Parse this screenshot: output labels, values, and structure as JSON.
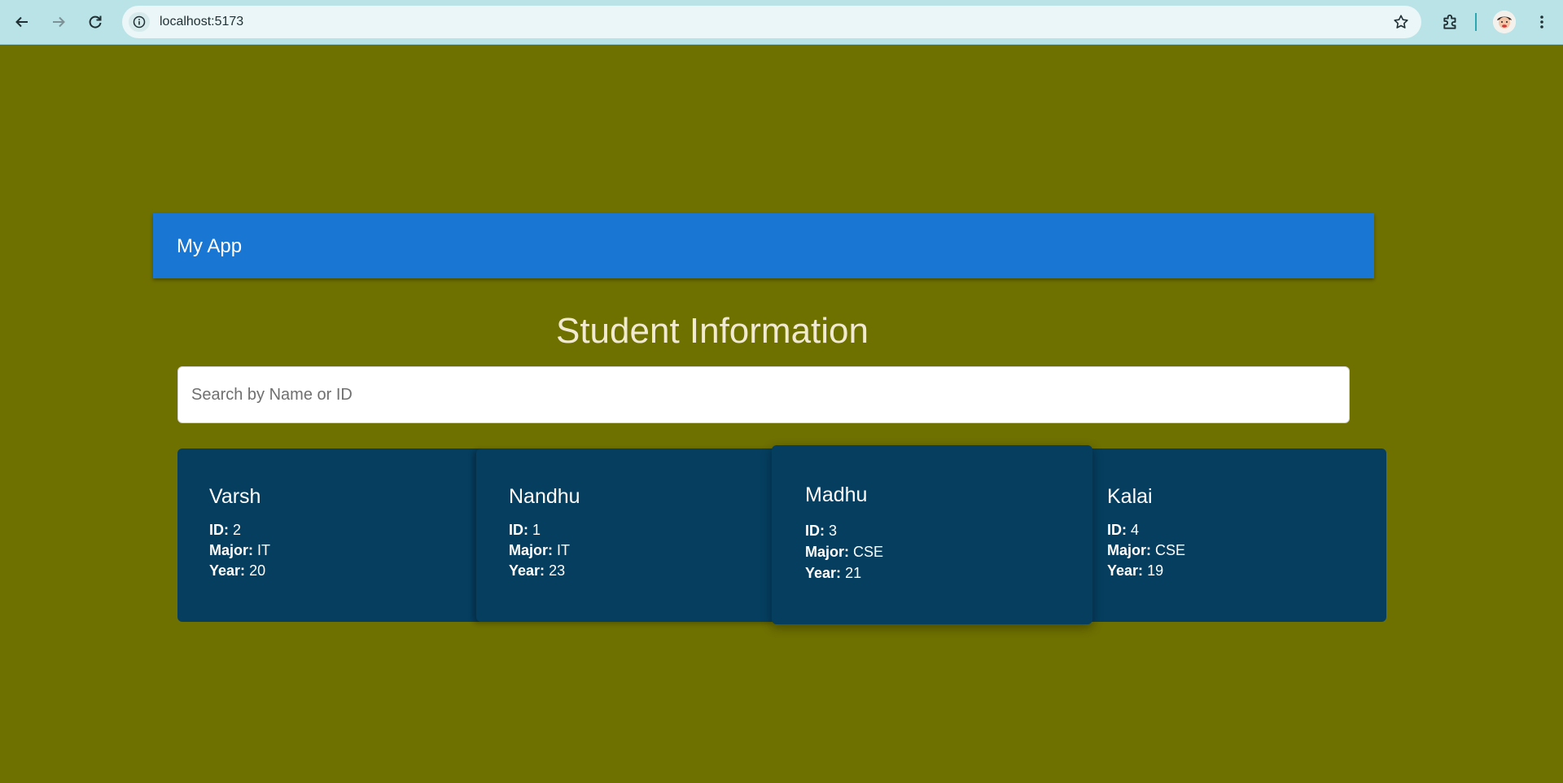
{
  "browser": {
    "url": "localhost:5173",
    "icons": {
      "back": "back-arrow-icon",
      "forward": "forward-arrow-icon",
      "reload": "reload-icon",
      "site_info": "site-info-icon",
      "bookmark": "star-icon",
      "extensions": "puzzle-icon",
      "menu": "kebab-menu-icon"
    }
  },
  "app": {
    "title": "My App",
    "heading": "Student Information",
    "search_placeholder": "Search by Name or ID",
    "labels": {
      "id": "ID:",
      "major": "Major:",
      "year": "Year:"
    },
    "students": [
      {
        "name": "Varsh",
        "id": "2",
        "major": "IT",
        "year": "20"
      },
      {
        "name": "Nandhu",
        "id": "1",
        "major": "IT",
        "year": "23"
      },
      {
        "name": "Madhu",
        "id": "3",
        "major": "CSE",
        "year": "21"
      },
      {
        "name": "Kalai",
        "id": "4",
        "major": "CSE",
        "year": "19"
      }
    ]
  },
  "colors": {
    "page_background": "#6e7000",
    "appbar": "#1976d2",
    "card": "#053e5f",
    "heading_text": "#f2ead0",
    "chrome": "#b9e3e6"
  }
}
